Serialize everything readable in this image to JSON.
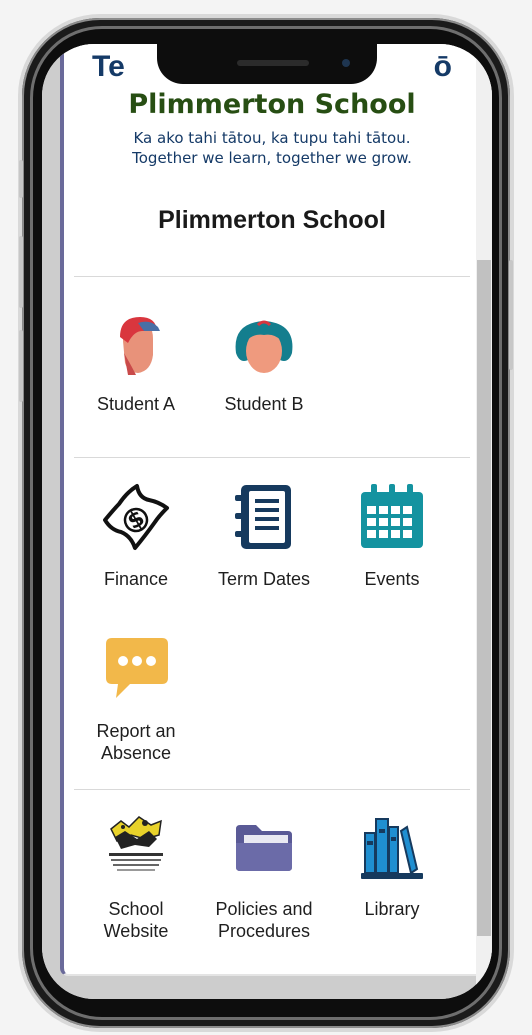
{
  "header": {
    "logo_te": "Te",
    "logo_o": "ō",
    "school_name_logo": "Plimmerton School",
    "motto_maori": "Ka ako tahi tātou, ka tupu tahi tātou.",
    "motto_english": "Together we learn, together we grow."
  },
  "page": {
    "title": "Plimmerton School"
  },
  "students": [
    {
      "label": "Student A",
      "icon": "boy-avatar-icon"
    },
    {
      "label": "Student B",
      "icon": "girl-avatar-icon"
    }
  ],
  "tiles_row1": [
    {
      "label": "Finance",
      "icon": "money-bill-icon"
    },
    {
      "label": "Term Dates",
      "icon": "notebook-icon"
    },
    {
      "label": "Events",
      "icon": "calendar-icon"
    }
  ],
  "tiles_row2": [
    {
      "label_line1": "Report an",
      "label_line2": "Absence",
      "icon": "chat-bubble-icon"
    }
  ],
  "tiles_row3": [
    {
      "label_line1": "School",
      "label_line2": "Website",
      "icon": "school-logo-icon"
    },
    {
      "label_line1": "Policies and",
      "label_line2": "Procedures",
      "icon": "folder-icon"
    },
    {
      "label": "Library",
      "icon": "books-icon"
    }
  ],
  "colors": {
    "navy": "#153a67",
    "green": "#274e13",
    "teal": "#1493a0",
    "yellow": "#f2b84a",
    "folder": "#5a5a96"
  }
}
